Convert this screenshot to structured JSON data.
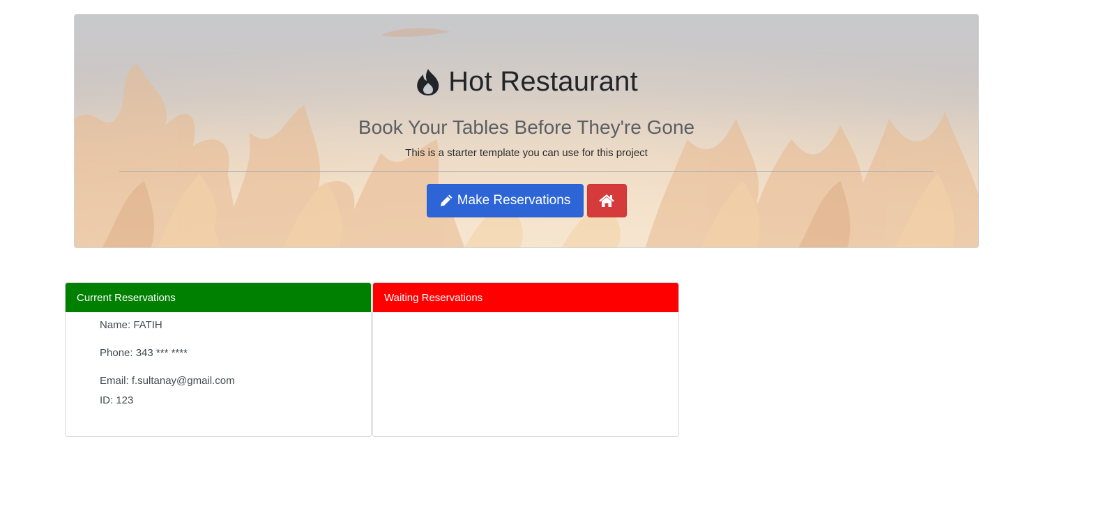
{
  "jumbotron": {
    "title": "Hot Restaurant",
    "subtitle": "Book Your Tables Before They're Gone",
    "lead": "This is a starter template you can use for this project",
    "make_reservation_label": "Make Reservations",
    "icons": {
      "title": "fire-icon",
      "make_reservation": "pencil-icon",
      "home": "home-icon"
    }
  },
  "current": {
    "header": "Current Reservations",
    "reservations": [
      {
        "name": "Name: FATIH",
        "phone": "Phone: 343 *** ****",
        "email": "Email: f.sultanay@gmail.com",
        "id": "ID: 123"
      }
    ]
  },
  "waiting": {
    "header": "Waiting Reservations",
    "reservations": []
  },
  "colors": {
    "current_header": "#008000",
    "waiting_header": "#ff0000",
    "primary_button": "#2d65d6",
    "danger_button": "#d63b3b"
  }
}
